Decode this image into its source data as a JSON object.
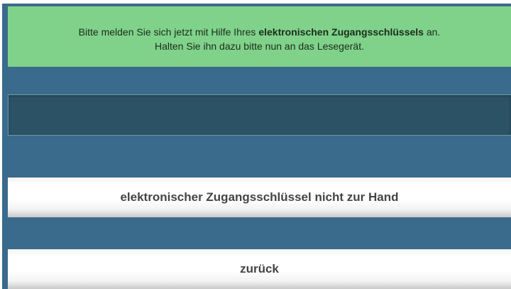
{
  "notice": {
    "line1_before": "Bitte melden Sie sich jetzt mit Hilfe Ihres ",
    "line1_bold": "elektronischen Zugangsschlüssels",
    "line1_after": " an.",
    "line2": "Halten Sie ihn dazu bitte nun an das Lesegerät."
  },
  "card_input": {
    "value": ""
  },
  "buttons": {
    "no_key_label": "elektronischer Zugangsschlüssel nicht zur Hand",
    "back_label": "zurück"
  },
  "colors": {
    "panel_bg": "#3a6b8c",
    "notice_bg": "#80d28a",
    "input_bg": "#2c5266"
  }
}
